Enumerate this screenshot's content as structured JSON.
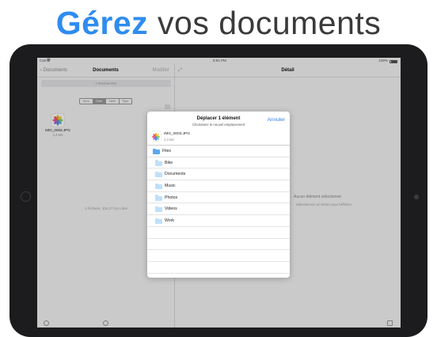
{
  "headline": {
    "highlight": "Gérez",
    "rest": "vos documents"
  },
  "colors": {
    "accent": "#2f8cf0",
    "link": "#2f7cf6",
    "folder": "#bfe0fb"
  },
  "status_bar": {
    "carrier": "Carrier",
    "time": "5:91 PM",
    "battery": "100%"
  },
  "documents": {
    "back_label": "Documents",
    "title": "Documents",
    "modify_label": "Modifier",
    "search_placeholder": "Rechercher",
    "sort_options": [
      "Nom",
      "Date",
      "Taille",
      "Type"
    ],
    "selected_sort_index": 1,
    "sort_icon": "list-icon",
    "file": {
      "name": "IMG_0003.JPG",
      "size": "2,4 Mo",
      "icon": "photos-icon"
    },
    "footer": "1 Fichiers, 104,27 Go Libre"
  },
  "detail": {
    "title": "Détail",
    "placeholder_title": "Aucun élément sélectionné",
    "placeholder_sub": "Sélectionnez un fichier pour l'afficher"
  },
  "move_dialog": {
    "title": "Déplacer 1 élément",
    "subtitle": "Choisissez le nouvel emplacement",
    "cancel_label": "Annuler",
    "file": {
      "name": "IMG_0003.JPG",
      "size": "2,4 Mo"
    },
    "folders": [
      {
        "label": "Files",
        "level": 0
      },
      {
        "label": "Bike",
        "level": 1
      },
      {
        "label": "Documents",
        "level": 1
      },
      {
        "label": "Music",
        "level": 1
      },
      {
        "label": "Photos",
        "level": 1
      },
      {
        "label": "Videos",
        "level": 1
      },
      {
        "label": "Work",
        "level": 1
      }
    ],
    "empty_rows": 4
  }
}
